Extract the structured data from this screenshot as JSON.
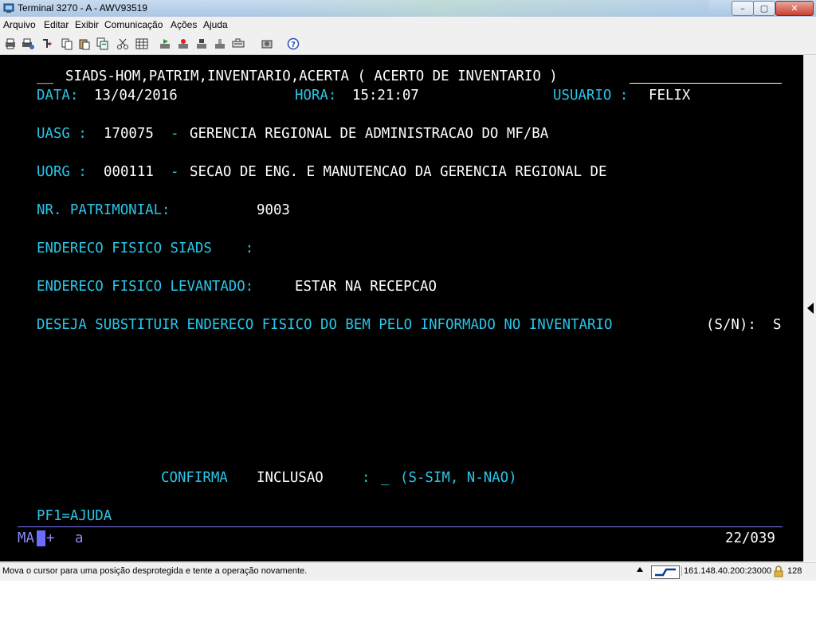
{
  "window": {
    "title": "Terminal 3270 - A - AWV93519",
    "min_label": "–",
    "max_label": "▢",
    "close_label": "✕"
  },
  "menu": {
    "items": [
      "Arquivo",
      "Editar",
      "Exibir",
      "Comunicação",
      "Ações",
      "Ajuda"
    ]
  },
  "toolbar": {
    "icons": [
      "print-screen-icon",
      "print-setup-icon",
      "receive-file-icon",
      "copy-icon",
      "paste-icon",
      "copy-append-icon",
      "cut-icon",
      "grid-icon",
      "macro-play-icon",
      "macro-record-icon",
      "macro-stop-icon",
      "disconnect-icon",
      "keyboard-icon",
      "settings-icon",
      "help-icon"
    ]
  },
  "screen": {
    "header_prefix": "__",
    "header_title": "SIADS-HOM,PATRIM,INVENTARIO,ACERTA ( ACERTO DE INVENTARIO )",
    "data_label": "DATA:",
    "data_value": "13/04/2016",
    "hora_label": "HORA:",
    "hora_value": "15:21:07",
    "usuario_label": "USUARIO :",
    "usuario_value": "FELIX",
    "uasg_label": "UASG :",
    "uasg_code": "170075",
    "uasg_sep": "-",
    "uasg_name": "GERENCIA REGIONAL DE ADMINISTRACAO DO MF/BA",
    "uorg_label": "UORG :",
    "uorg_code": "000111",
    "uorg_sep": "-",
    "uorg_name": "SECAO DE ENG. E MANUTENCAO DA GERENCIA REGIONAL DE",
    "patrimonial_label": "NR. PATRIMONIAL:",
    "patrimonial_value": "9003",
    "end_siads_label": "ENDERECO FISICO SIADS    :",
    "end_levantado_label": "ENDERECO FISICO LEVANTADO:",
    "end_levantado_value": "ESTAR NA RECEPCAO",
    "deseja_label": "DESEJA SUBSTITUIR ENDERECO FISICO DO BEM PELO INFORMADO NO INVENTARIO",
    "deseja_sn": "(S/N):",
    "deseja_value": "S",
    "confirma_label": "CONFIRMA",
    "inclusao_label": "INCLUSAO",
    "confirma_colon": ":",
    "confirma_input": "_",
    "confirma_hint": "(S-SIM, N-NAO)",
    "pf1": "PF1=AJUDA"
  },
  "oia": {
    "mode": "MA",
    "plus": "+",
    "field": "a",
    "cursor_pos": "22/039"
  },
  "status": {
    "message": "Mova o cursor para uma posição desprotegida e tente a operação novamente.",
    "host": "161.148.40.200:23000",
    "port": "128"
  },
  "colors": {
    "terminal_bg": "#000000",
    "protected_text": "#29c6e8",
    "input_text": "#ffffff",
    "oia_line": "#7a7aff"
  }
}
